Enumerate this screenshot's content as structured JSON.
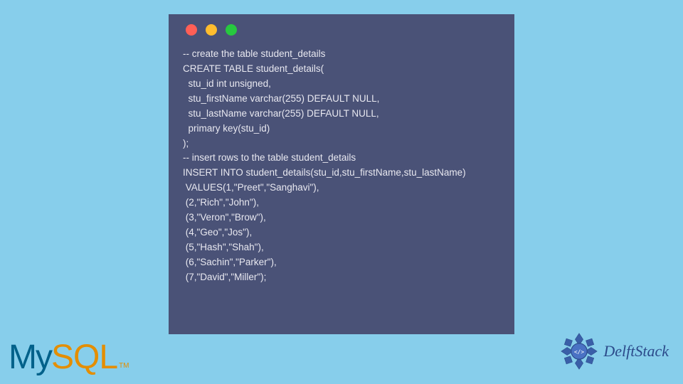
{
  "code_lines": [
    "-- create the table student_details",
    "CREATE TABLE student_details(",
    "  stu_id int unsigned,",
    "  stu_firstName varchar(255) DEFAULT NULL,",
    "  stu_lastName varchar(255) DEFAULT NULL,",
    "  primary key(stu_id)",
    ");",
    "-- insert rows to the table student_details",
    "INSERT INTO student_details(stu_id,stu_firstName,stu_lastName)",
    " VALUES(1,\"Preet\",\"Sanghavi\"),",
    " (2,\"Rich\",\"John\"),",
    " (3,\"Veron\",\"Brow\"),",
    " (4,\"Geo\",\"Jos\"),",
    " (5,\"Hash\",\"Shah\"),",
    " (6,\"Sachin\",\"Parker\"),",
    " (7,\"David\",\"Miller\");"
  ],
  "logos": {
    "mysql_my": "My",
    "mysql_sql": "SQL",
    "mysql_tm": "TM",
    "delftstack": "DelftStack"
  }
}
